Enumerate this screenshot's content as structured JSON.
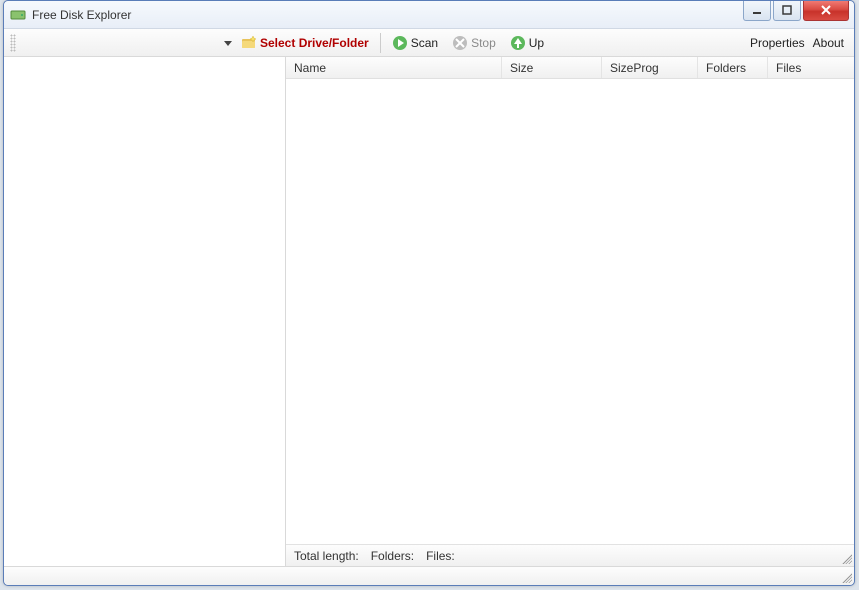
{
  "window": {
    "title": "Free Disk Explorer"
  },
  "toolbar": {
    "select_label": "Select Drive/Folder",
    "scan_label": "Scan",
    "stop_label": "Stop",
    "up_label": "Up",
    "properties_label": "Properties",
    "about_label": "About"
  },
  "columns": {
    "name": "Name",
    "size": "Size",
    "sizeprog": "SizeProg",
    "folders": "Folders",
    "files": "Files"
  },
  "status": {
    "total_length_label": "Total length:",
    "folders_label": "Folders:",
    "files_label": "Files:",
    "total_length_value": "",
    "folders_value": "",
    "files_value": ""
  }
}
